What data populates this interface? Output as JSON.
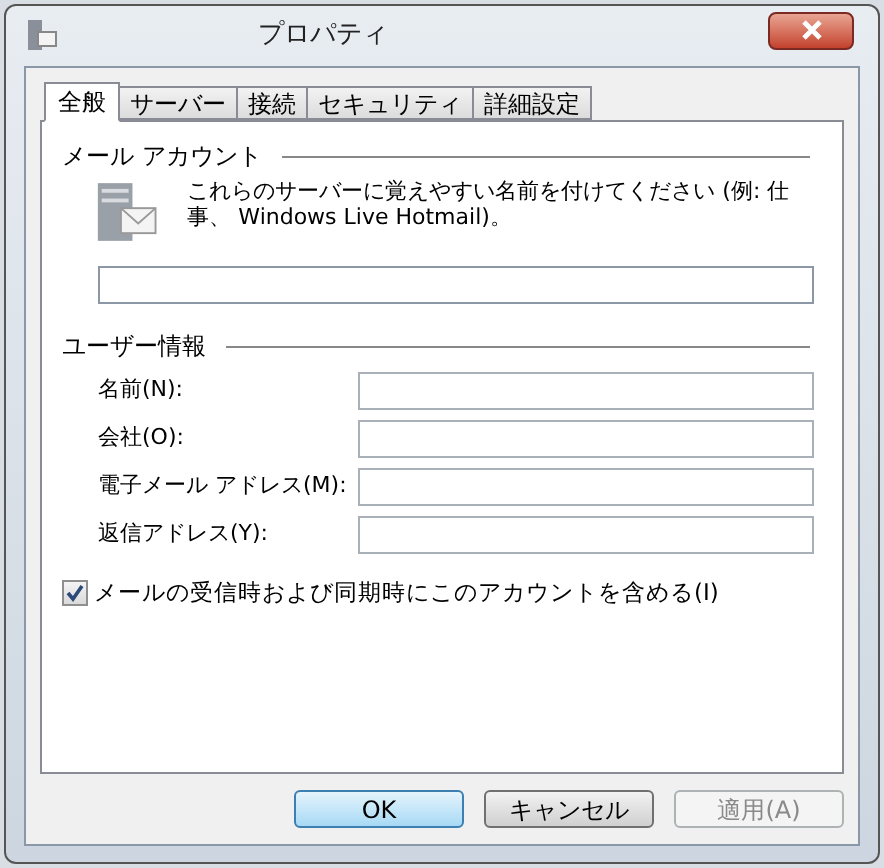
{
  "window": {
    "title": "プロパティ"
  },
  "tabs": [
    {
      "label": "全般",
      "selected": true
    },
    {
      "label": "サーバー",
      "selected": false
    },
    {
      "label": "接続",
      "selected": false
    },
    {
      "label": "セキュリティ",
      "selected": false
    },
    {
      "label": "詳細設定",
      "selected": false
    }
  ],
  "mail_account": {
    "heading": "メール アカウント",
    "description": "これらのサーバーに覚えやすい名前を付けてください (例: 仕事、 Windows Live Hotmail)。"
  },
  "user_info": {
    "heading": "ユーザー情報",
    "fields": [
      {
        "label": "名前(N):"
      },
      {
        "label": "会社(O):"
      },
      {
        "label": "電子メール アドレス(M):"
      },
      {
        "label": "返信アドレス(Y):"
      }
    ]
  },
  "include_account": {
    "label": "メールの受信時および同期時にこのアカウントを含める(I)",
    "checked": true
  },
  "buttons": [
    {
      "label": "OK",
      "default": true,
      "disabled": false
    },
    {
      "label": "キャンセル",
      "default": false,
      "disabled": false
    },
    {
      "label": "適用(A)",
      "default": false,
      "disabled": true
    }
  ]
}
